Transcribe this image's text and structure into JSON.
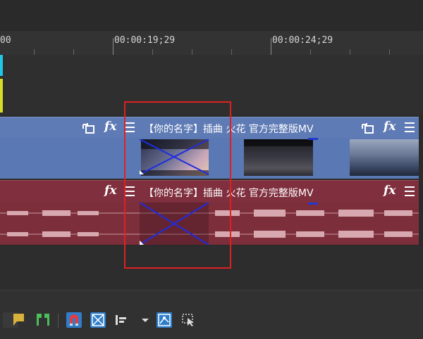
{
  "ruler": {
    "labels": [
      "00",
      "00:00:19;29",
      "00:00:24;29"
    ]
  },
  "video_track": {
    "clip_title": "【你的名字】插曲 火花 官方完整版MV",
    "icons": [
      "track-motion-icon",
      "fx-icon",
      "menu-icon"
    ],
    "color": "#5f7bb5"
  },
  "audio_track": {
    "clip_title": "【你的名字】插曲 火花 官方完整版MV",
    "icons": [
      "fx-icon",
      "menu-icon"
    ],
    "color": "#7f2f3e"
  },
  "fx_label": "fx",
  "toolbar": {
    "buttons": [
      "marker-icon",
      "region-icon",
      "snap-magnet-icon",
      "auto-crossfade-icon",
      "ripple-edit-icon",
      "dropdown-arrow-icon",
      "lock-envelopes-icon",
      "select-tool-icon"
    ]
  },
  "highlight_color": "#e02020"
}
